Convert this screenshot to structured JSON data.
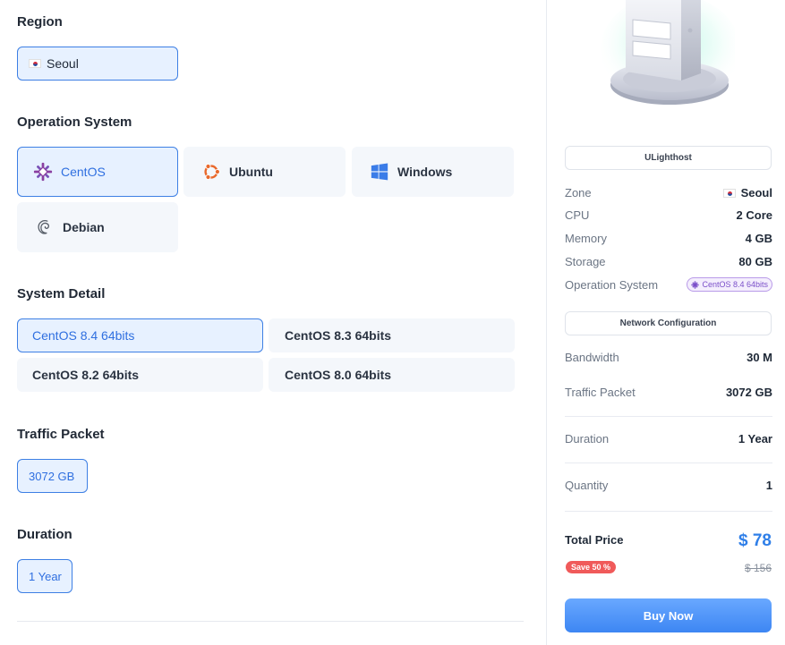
{
  "region": {
    "title": "Region",
    "selected": "Seoul"
  },
  "os": {
    "title": "Operation System",
    "options": [
      "CentOS",
      "Ubuntu",
      "Windows",
      "Debian"
    ],
    "selected": "CentOS"
  },
  "system_detail": {
    "title": "System Detail",
    "options": [
      "CentOS 8.4 64bits",
      "CentOS 8.3 64bits",
      "CentOS 8.2 64bits",
      "CentOS 8.0 64bits"
    ],
    "selected": "CentOS 8.4 64bits"
  },
  "traffic": {
    "title": "Traffic Packet",
    "selected": "3072 GB"
  },
  "duration": {
    "title": "Duration",
    "selected": "1 Year"
  },
  "summary": {
    "host_label": "ULighthost",
    "zone": {
      "label": "Zone",
      "value": "Seoul"
    },
    "cpu": {
      "label": "CPU",
      "value": "2 Core"
    },
    "memory": {
      "label": "Memory",
      "value": "4 GB"
    },
    "storage": {
      "label": "Storage",
      "value": "80 GB"
    },
    "os": {
      "label": "Operation System",
      "value": "CentOS 8.4 64bits"
    },
    "network_label": "Network Configuration",
    "bandwidth": {
      "label": "Bandwidth",
      "value": "30 M"
    },
    "traffic": {
      "label": "Traffic Packet",
      "value": "3072 GB"
    },
    "duration": {
      "label": "Duration",
      "value": "1 Year"
    },
    "quantity": {
      "label": "Quantity",
      "value": "1"
    },
    "total_label": "Total Price",
    "total_value": "$ 78",
    "save_badge": "Save 50 %",
    "old_price": "$ 156",
    "buy_label": "Buy Now"
  },
  "colors": {
    "accent": "#3d86f3",
    "selected_bg": "#e7f1ff",
    "save_badge": "#f05a5a",
    "os_badge": "#7b4fc9"
  },
  "icons": {
    "centos": "centos-icon",
    "ubuntu": "ubuntu-icon",
    "windows": "windows-icon",
    "debian": "debian-icon",
    "flag": "korea-flag-icon"
  }
}
